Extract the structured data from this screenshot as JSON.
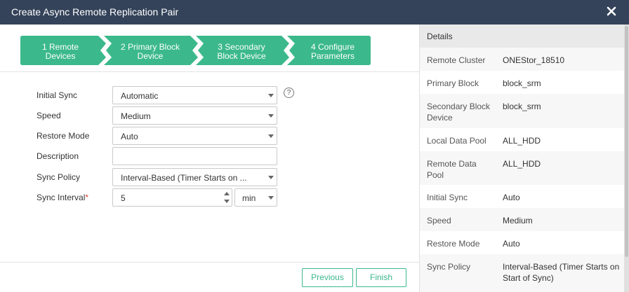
{
  "window": {
    "title": "Create Async Remote Replication Pair",
    "close_icon": "close-icon"
  },
  "steps": [
    {
      "label": "1 Remote Devices",
      "line1": "1 Remote",
      "line2": "Devices"
    },
    {
      "label": "2 Primary Block Device",
      "line1": "2 Primary Block",
      "line2": "Device"
    },
    {
      "label": "3 Secondary Block Device",
      "line1": "3 Secondary",
      "line2": "Block Device"
    },
    {
      "label": "4 Configure Parameters",
      "line1": "4 Configure",
      "line2": "Parameters"
    }
  ],
  "form": {
    "initial_sync": {
      "label": "Initial Sync",
      "value": "Automatic",
      "help": "?"
    },
    "speed": {
      "label": "Speed",
      "value": "Medium"
    },
    "restore_mode": {
      "label": "Restore Mode",
      "value": "Auto"
    },
    "description": {
      "label": "Description",
      "value": ""
    },
    "sync_policy": {
      "label": "Sync Policy",
      "value": "Interval-Based (Timer Starts on ..."
    },
    "sync_interval": {
      "label": "Sync Interval",
      "required_mark": "*",
      "value": "5",
      "unit": "min"
    }
  },
  "buttons": {
    "previous": "Previous",
    "finish": "Finish"
  },
  "details": {
    "header": "Details",
    "rows": [
      {
        "key": "Remote Cluster",
        "value": "ONEStor_18510"
      },
      {
        "key": "Primary Block",
        "value": "block_srm"
      },
      {
        "key": "Secondary Block Device",
        "value": "block_srm"
      },
      {
        "key": "Local Data Pool",
        "value": "ALL_HDD"
      },
      {
        "key": "Remote Data Pool",
        "value": "ALL_HDD"
      },
      {
        "key": "Initial Sync",
        "value": "Auto"
      },
      {
        "key": "Speed",
        "value": "Medium"
      },
      {
        "key": "Restore Mode",
        "value": "Auto"
      },
      {
        "key": "Sync Policy",
        "value": "Interval-Based (Timer Starts on Start of Sync)"
      }
    ]
  },
  "colors": {
    "titlebar": "#34435a",
    "accent": "#3cb98c",
    "required": "#e0413a"
  }
}
